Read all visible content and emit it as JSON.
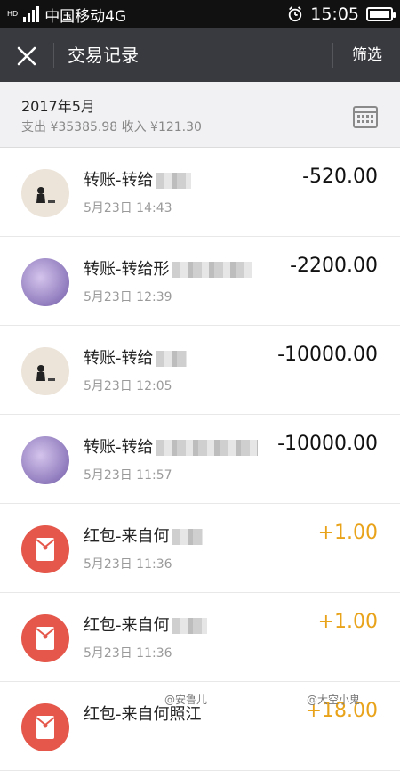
{
  "status": {
    "carrier": "中国移动4G",
    "network_tag": "HD",
    "time": "15:05",
    "icons": [
      "signal-icon",
      "alarm-icon",
      "battery-icon"
    ]
  },
  "header": {
    "title": "交易记录",
    "filter_label": "筛选",
    "close_icon": "close-icon"
  },
  "summary": {
    "month": "2017年5月",
    "stats": "支出 ¥35385.98 收入 ¥121.30",
    "calendar_icon": "calendar-icon"
  },
  "transactions": [
    {
      "desc": "转账-转给",
      "time": "5月23日 14:43",
      "amount": "-520.00",
      "type": "expense",
      "avatar": "photo-avatar"
    },
    {
      "desc": "转账-转给形",
      "time": "5月23日 12:39",
      "amount": "-2200.00",
      "type": "expense",
      "avatar": "photo-avatar"
    },
    {
      "desc": "转账-转给",
      "time": "5月23日 12:05",
      "amount": "-10000.00",
      "type": "expense",
      "avatar": "photo-avatar"
    },
    {
      "desc": "转账-转给",
      "time": "5月23日 11:57",
      "amount": "-10000.00",
      "type": "expense",
      "avatar": "photo-avatar"
    },
    {
      "desc": "红包-来自何",
      "time": "5月23日 11:36",
      "amount": "+1.00",
      "type": "income",
      "avatar": "red-packet-icon"
    },
    {
      "desc": "红包-来自何",
      "time": "5月23日 11:36",
      "amount": "+1.00",
      "type": "income",
      "avatar": "red-packet-icon"
    },
    {
      "desc": "红包-来自何照江",
      "time": "",
      "amount": "+18.00",
      "type": "income",
      "avatar": "red-packet-icon"
    }
  ],
  "watermark": {
    "left": "@安鲁儿",
    "right": "@大空小鬼"
  },
  "colors": {
    "nav_bg": "#393a3f",
    "income": "#e9a31b",
    "red_packet": "#e4574a"
  }
}
